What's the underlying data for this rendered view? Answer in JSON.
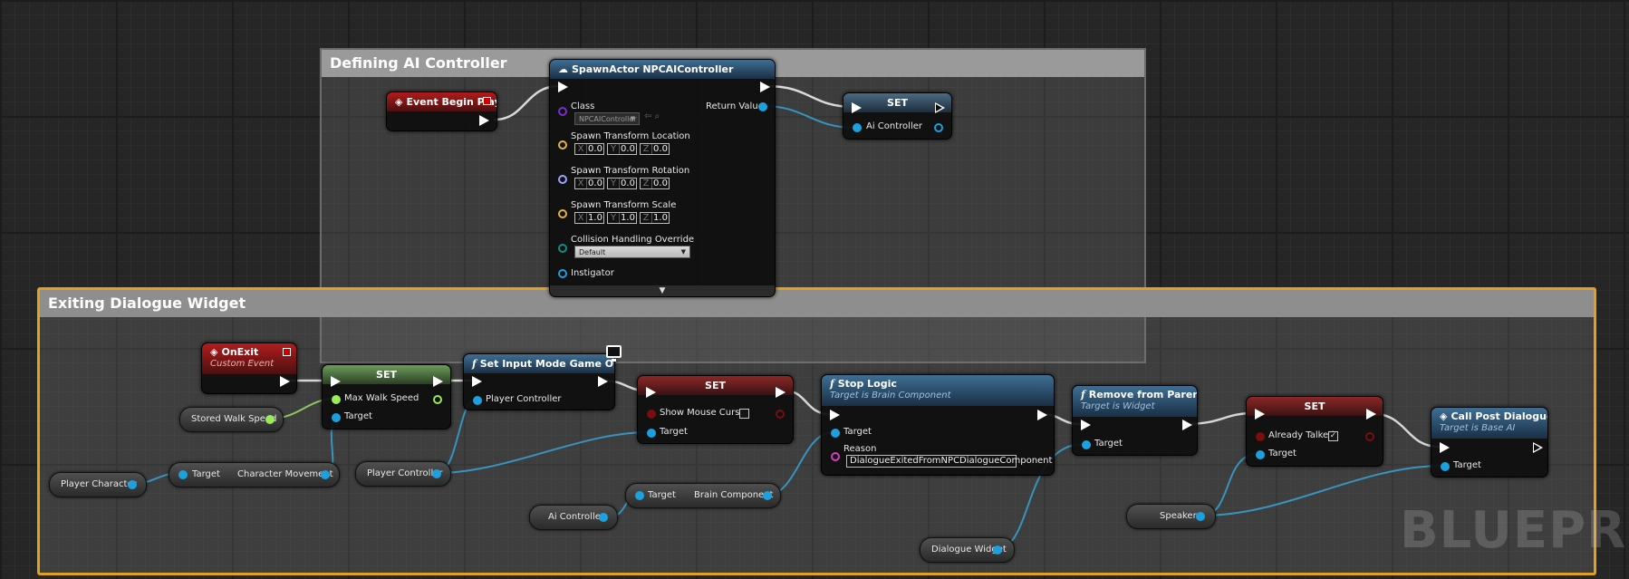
{
  "watermark": "BLUEPRINT",
  "comments": {
    "defining": "Defining AI Controller",
    "exiting": "Exiting Dialogue Widget"
  },
  "event_begin_play": {
    "title": "Event Begin Play"
  },
  "spawn_actor": {
    "title": "SpawnActor NPCAIController",
    "class_label": "Class",
    "class_value": "NPCAIController",
    "return_label": "Return Value",
    "location_label": "Spawn Transform Location",
    "rotation_label": "Spawn Transform Rotation",
    "scale_label": "Spawn Transform Scale",
    "axis_x": "X",
    "axis_y": "Y",
    "axis_z": "Z",
    "location": [
      "0.0",
      "0.0",
      "0.0"
    ],
    "rotation": [
      "0.0",
      "0.0",
      "0.0"
    ],
    "scale": [
      "1.0",
      "1.0",
      "1.0"
    ],
    "collision_label": "Collision Handling Override",
    "collision_value": "Default",
    "instigator_label": "Instigator",
    "expander": "▼"
  },
  "set_ai": {
    "title": "SET",
    "var_label": "Ai Controller"
  },
  "on_exit": {
    "title": "OnExit",
    "subtitle": "Custom Event"
  },
  "set_speed": {
    "title": "SET",
    "max_walk_label": "Max Walk Speed",
    "target_label": "Target"
  },
  "set_input": {
    "title": "Set Input Mode Game Only",
    "player_controller_label": "Player Controller"
  },
  "set_cursor": {
    "title": "SET",
    "show_cursor_label": "Show Mouse Cursor",
    "target_label": "Target"
  },
  "stop_logic": {
    "title": "Stop Logic",
    "subtitle": "Target is Brain Component",
    "target_label": "Target",
    "reason_label": "Reason",
    "reason_value": "DialogueExitedFromNPCDialogueComponent"
  },
  "remove_parent": {
    "title": "Remove from Parent",
    "subtitle": "Target is Widget",
    "target_label": "Target"
  },
  "set_talked": {
    "title": "SET",
    "already_talked_label": "Already Talked",
    "target_label": "Target",
    "check": "✓"
  },
  "call_post": {
    "title": "Call Post Dialogue",
    "subtitle": "Target is Base AI",
    "target_label": "Target"
  },
  "char_movement": {
    "target_label": "Target",
    "output_label": "Character Movement"
  },
  "brain_component": {
    "target_label": "Target",
    "output_label": "Brain Component"
  },
  "variables": {
    "stored_walk_speed": "Stored Walk Speed",
    "player_character": "Player Character",
    "player_controller": "Player Controller",
    "ai_controller": "Ai Controller",
    "dialogue_widget": "Dialogue Widget",
    "speaker": "Speaker"
  },
  "icons": {
    "event": "event-diamond-icon",
    "function": "function-f-icon",
    "spawn": "spawn-actor-icon",
    "monitor": "monitor-icon"
  },
  "colors": {
    "exec": "#ffffff",
    "object_pin": "#1ca1de",
    "float_pin": "#9aea5a",
    "bool_pin": "#7a0d0d",
    "comment_selected": "#e0a020"
  }
}
